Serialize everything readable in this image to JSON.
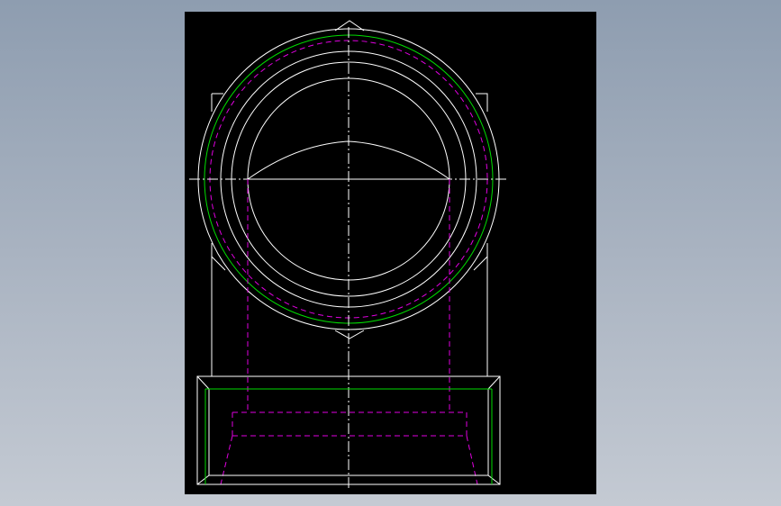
{
  "drawing": {
    "background_color": "#000000",
    "colors": {
      "visible_line": "#ffffff",
      "thread_line": "#00e000",
      "hidden_line": "#e000e0",
      "center_line": "#ffffff"
    },
    "line_types": [
      "visible",
      "hidden-dashed",
      "center-dash-dot",
      "thread"
    ],
    "views": [
      "end-view-circle",
      "hex-body",
      "base-section"
    ]
  }
}
